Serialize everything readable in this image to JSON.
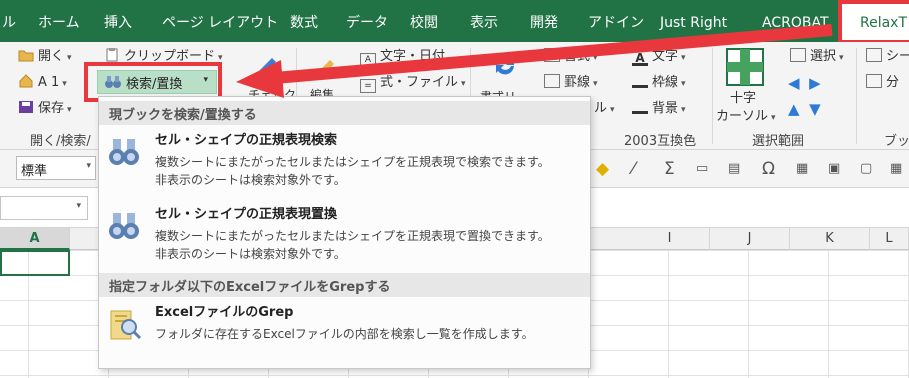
{
  "tabs": [
    "ル",
    "ホーム",
    "挿入",
    "ページ レイアウト",
    "数式",
    "データ",
    "校閲",
    "表示",
    "開発",
    "アドイン",
    "Just Right",
    "ACROBAT"
  ],
  "active_tab": "RelaxT",
  "ribbon": {
    "open_label": "開く",
    "a1_label": "A 1",
    "save_label": "保存",
    "clipboard_label": "クリップボード",
    "search_replace_label": "検索/置換",
    "check_label": "チェック",
    "edit_label": "編集",
    "text_date_label": "文字・日付",
    "formula_file_label": "式・ファイル",
    "format_label": "書式",
    "border_label": "罫線",
    "style_label": "ル",
    "text_label": "文字",
    "border_line_label": "枠線",
    "background_label": "背景",
    "select_label": "選択",
    "cross_cursor_label_1": "十字",
    "cross_cursor_label_2": "カーソル",
    "sheet_label": "シー",
    "split_label": "分",
    "partial_left_label": "書式リ",
    "group_open_search": "開く/検索/",
    "group_compat": "2003互換色",
    "group_select_range": "選択範囲",
    "group_book": "ブック"
  },
  "format_bar": {
    "style_value": "標準"
  },
  "columns": [
    "A",
    "I",
    "J",
    "K",
    "L"
  ],
  "dropdown": {
    "section1": "現ブックを検索/置換する",
    "item1_title": "セル・シェイプの正規表現検索",
    "item1_desc1": "複数シートにまたがったセルまたはシェイプを正規表現で検索できます。",
    "item1_desc2": "非表示のシートは検索対象外です。",
    "item2_title": "セル・シェイプの正規表現置換",
    "item2_desc1": "複数シートにまたがったセルまたはシェイプを正規表現で置換できます。",
    "item2_desc2": "非表示のシートは検索対象外です。",
    "section2": "指定フォルダ以下のExcelファイルをGrepする",
    "item3_title": "ExcelファイルのGrep",
    "item3_desc1": "フォルダに存在するExcelファイルの内部を検索し一覧を作成します。"
  },
  "colors": {
    "excel_green": "#217346",
    "highlight_red": "#e8383d",
    "button_green": "#b9dfc7"
  }
}
